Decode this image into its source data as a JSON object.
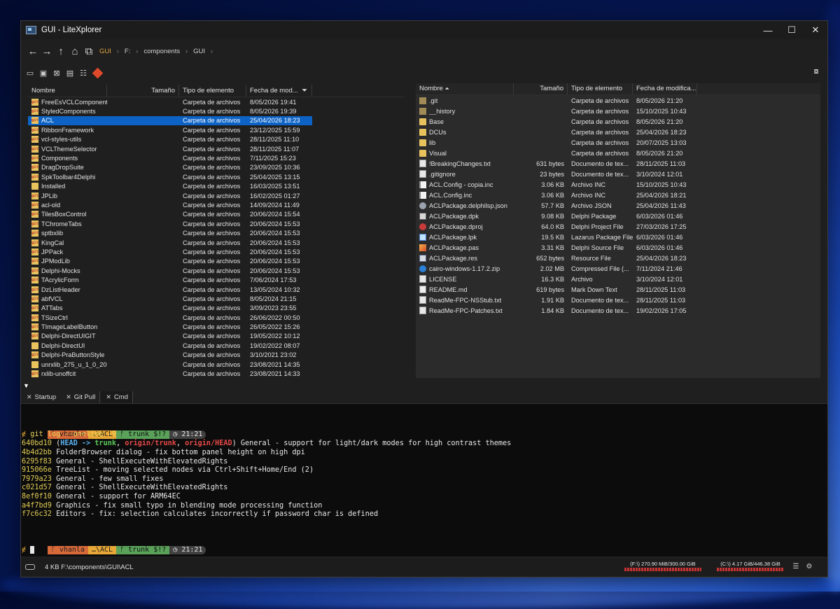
{
  "window": {
    "title": "GUI - LiteXplorer"
  },
  "controls": {
    "minimize": "—",
    "maximize": "☐",
    "close": "✕"
  },
  "nav": {
    "back": "←",
    "forward": "→",
    "up": "↑",
    "home": "⌂",
    "copy": "⧉",
    "breadcrumbs": [
      "GUI",
      "F:",
      "components",
      "GUI"
    ],
    "sep": "›"
  },
  "toolbar": {
    "icons": [
      "panel-toggle-icon",
      "new-folder-icon",
      "delete-icon",
      "properties-icon",
      "view-icon",
      "git-icon"
    ],
    "right_icon": "screenshot-icon"
  },
  "left_pane": {
    "columns": [
      "Nombre",
      "Tamaño",
      "Tipo de elemento",
      "Fecha de mod..."
    ],
    "sort_indicator": "⏷",
    "rows": [
      {
        "name": "FreeEsVCLComponents",
        "type": "Carpeta de archivos",
        "date": "8/05/2026 19:41",
        "icon": "git"
      },
      {
        "name": "StyledComponents",
        "type": "Carpeta de archivos",
        "date": "8/05/2026 19:39",
        "icon": "git"
      },
      {
        "name": "ACL",
        "type": "Carpeta de archivos",
        "date": "25/04/2026 18:23",
        "icon": "git",
        "selected": true
      },
      {
        "name": "RibbonFramework",
        "type": "Carpeta de archivos",
        "date": "23/12/2025 15:59",
        "icon": "git"
      },
      {
        "name": "vcl-styles-utils",
        "type": "Carpeta de archivos",
        "date": "28/11/2025 11:10",
        "icon": "git"
      },
      {
        "name": "VCLThemeSelector",
        "type": "Carpeta de archivos",
        "date": "28/11/2025 11:07",
        "icon": "git"
      },
      {
        "name": "Components",
        "type": "Carpeta de archivos",
        "date": "7/11/2025 15:23",
        "icon": "git"
      },
      {
        "name": "DragDropSuite",
        "type": "Carpeta de archivos",
        "date": "23/09/2025 10:36",
        "icon": "git"
      },
      {
        "name": "SpkToolbar4Delphi",
        "type": "Carpeta de archivos",
        "date": "25/04/2025 13:15",
        "icon": "git"
      },
      {
        "name": "Installed",
        "type": "Carpeta de archivos",
        "date": "16/03/2025 13:51",
        "icon": "folder"
      },
      {
        "name": "JPLib",
        "type": "Carpeta de archivos",
        "date": "16/02/2025 01:27",
        "icon": "git"
      },
      {
        "name": "acl-old",
        "type": "Carpeta de archivos",
        "date": "14/09/2024 11:49",
        "icon": "git"
      },
      {
        "name": "TilesBoxControl",
        "type": "Carpeta de archivos",
        "date": "20/06/2024 15:54",
        "icon": "git"
      },
      {
        "name": "TChromeTabs",
        "type": "Carpeta de archivos",
        "date": "20/06/2024 15:53",
        "icon": "git"
      },
      {
        "name": "sptbxlib",
        "type": "Carpeta de archivos",
        "date": "20/06/2024 15:53",
        "icon": "git"
      },
      {
        "name": "KingCal",
        "type": "Carpeta de archivos",
        "date": "20/06/2024 15:53",
        "icon": "git"
      },
      {
        "name": "JPPack",
        "type": "Carpeta de archivos",
        "date": "20/06/2024 15:53",
        "icon": "git"
      },
      {
        "name": "JPModLib",
        "type": "Carpeta de archivos",
        "date": "20/06/2024 15:53",
        "icon": "git"
      },
      {
        "name": "Delphi-Mocks",
        "type": "Carpeta de archivos",
        "date": "20/06/2024 15:53",
        "icon": "git"
      },
      {
        "name": "TAcrylicForm",
        "type": "Carpeta de archivos",
        "date": "7/06/2024 17:53",
        "icon": "git"
      },
      {
        "name": "DzListHeader",
        "type": "Carpeta de archivos",
        "date": "13/05/2024 10:32",
        "icon": "git"
      },
      {
        "name": "abfVCL",
        "type": "Carpeta de archivos",
        "date": "8/05/2024 21:15",
        "icon": "git"
      },
      {
        "name": "ATTabs",
        "type": "Carpeta de archivos",
        "date": "3/09/2023 23:55",
        "icon": "git"
      },
      {
        "name": "TSizeCtrl",
        "type": "Carpeta de archivos",
        "date": "26/06/2022 00:50",
        "icon": "git"
      },
      {
        "name": "TImageLabelButton",
        "type": "Carpeta de archivos",
        "date": "26/05/2022 15:26",
        "icon": "git"
      },
      {
        "name": "Delphi-DirectUIGIT",
        "type": "Carpeta de archivos",
        "date": "19/05/2022 10:12",
        "icon": "git"
      },
      {
        "name": "Delphi-DirectUI",
        "type": "Carpeta de archivos",
        "date": "19/02/2022 08:07",
        "icon": "folder"
      },
      {
        "name": "Delphi-PraButtonStyle",
        "type": "Carpeta de archivos",
        "date": "3/10/2021 23:02",
        "icon": "git"
      },
      {
        "name": "unrxlib_275_u_1_0_20",
        "type": "Carpeta de archivos",
        "date": "23/08/2021 14:35",
        "icon": "folder"
      },
      {
        "name": "rxlib-unoffcit",
        "type": "Carpeta de archivos",
        "date": "23/08/2021 14:33",
        "icon": "git"
      }
    ]
  },
  "right_pane": {
    "columns": [
      "Nombre",
      "Tamaño",
      "Tipo de elemento",
      "Fecha de modifica..."
    ],
    "sort_indicator": "⏶",
    "rows": [
      {
        "name": ".git",
        "size": "",
        "type": "Carpeta de archivos",
        "date": "8/05/2026 21:20",
        "icon": "folder-dark"
      },
      {
        "name": "__history",
        "size": "",
        "type": "Carpeta de archivos",
        "date": "15/10/2025 10:43",
        "icon": "folder-dark"
      },
      {
        "name": "Base",
        "size": "",
        "type": "Carpeta de archivos",
        "date": "8/05/2026 21:20",
        "icon": "folder"
      },
      {
        "name": "DCUs",
        "size": "",
        "type": "Carpeta de archivos",
        "date": "25/04/2026 18:23",
        "icon": "folder"
      },
      {
        "name": "lib",
        "size": "",
        "type": "Carpeta de archivos",
        "date": "20/07/2025 13:03",
        "icon": "folder"
      },
      {
        "name": "Visual",
        "size": "",
        "type": "Carpeta de archivos",
        "date": "8/05/2026 21:20",
        "icon": "folder"
      },
      {
        "name": "!BreakingChanges.txt",
        "size": "631 bytes",
        "type": "Documento de tex...",
        "date": "28/11/2025 11:03",
        "icon": "txt"
      },
      {
        "name": ".gitignore",
        "size": "23 bytes",
        "type": "Documento de tex...",
        "date": "3/10/2024 12:01",
        "icon": "txt"
      },
      {
        "name": "ACL.Config - copia.inc",
        "size": "3.06 KB",
        "type": "Archivo INC",
        "date": "15/10/2025 10:43",
        "icon": "inc"
      },
      {
        "name": "ACL.Config.inc",
        "size": "3.06 KB",
        "type": "Archivo INC",
        "date": "25/04/2026 18:21",
        "icon": "inc"
      },
      {
        "name": "ACLPackage.delphilsp.json",
        "size": "57.7 KB",
        "type": "Archivo JSON",
        "date": "25/04/2026 11:43",
        "icon": "json"
      },
      {
        "name": "ACLPackage.dpk",
        "size": "9.08 KB",
        "type": "Delphi Package",
        "date": "6/03/2026 01:46",
        "icon": "dpk"
      },
      {
        "name": "ACLPackage.dproj",
        "size": "64.0 KB",
        "type": "Delphi Project File",
        "date": "27/03/2026 17:25",
        "icon": "dproj"
      },
      {
        "name": "ACLPackage.lpk",
        "size": "19.5 KB",
        "type": "Lazarus Package File",
        "date": "6/03/2026 01:46",
        "icon": "lpk"
      },
      {
        "name": "ACLPackage.pas",
        "size": "3.31 KB",
        "type": "Delphi Source File",
        "date": "6/03/2026 01:46",
        "icon": "pas"
      },
      {
        "name": "ACLPackage.res",
        "size": "652 bytes",
        "type": "Resource File",
        "date": "25/04/2026 18:23",
        "icon": "res"
      },
      {
        "name": "cairo-windows-1.17.2.zip",
        "size": "2.02 MB",
        "type": "Compressed File (...",
        "date": "7/11/2024 21:46",
        "icon": "zip"
      },
      {
        "name": "LICENSE",
        "size": "16.3 KB",
        "type": "Archivo",
        "date": "3/10/2024 12:01",
        "icon": "txt"
      },
      {
        "name": "README.md",
        "size": "619 bytes",
        "type": "Mark Down Text",
        "date": "28/11/2025 11:03",
        "icon": "md"
      },
      {
        "name": "ReadMe-FPC-NSStub.txt",
        "size": "1.91 KB",
        "type": "Documento de tex...",
        "date": "28/11/2025 11:03",
        "icon": "txt"
      },
      {
        "name": "ReadMe-FPC-Patches.txt",
        "size": "1.84 KB",
        "type": "Documento de tex...",
        "date": "19/02/2026 17:05",
        "icon": "txt"
      }
    ]
  },
  "tabs": [
    {
      "label": "Startup",
      "active": false
    },
    {
      "label": "Git Pull",
      "active": false
    },
    {
      "label": "Cmd",
      "active": true
    }
  ],
  "tab_close": "✕",
  "terminal": {
    "prompt": {
      "user": "ᚴ vhanla",
      "path": "…\\ACL",
      "branch1": "ᚠ trunk $!?",
      "branch2": "ᚠ trunk $!?",
      "time": "◷ 21:21"
    },
    "prompt_char": "ɇ",
    "command": "git log --oneline -9",
    "first_commit": {
      "hash": "640bd10",
      "open": " (",
      "head": "HEAD -> ",
      "trunk": "trunk",
      "comma1": ", ",
      "origin_trunk": "origin/trunk",
      "comma2": ", ",
      "origin_head": "origin/HEAD",
      "close": ")",
      "msg": " General - support for light/dark modes for high contrast themes"
    },
    "commits": [
      {
        "hash": "4b4d2bb",
        "msg": " FolderBrowser dialog - fix bottom panel height on high dpi"
      },
      {
        "hash": "6295f83",
        "msg": " General - ShellExecuteWithElevatedRights"
      },
      {
        "hash": "915066e",
        "msg": " TreeList - moving selected nodes via Ctrl+Shift+Home/End (2)"
      },
      {
        "hash": "7979a23",
        "msg": " General - few small fixes"
      },
      {
        "hash": "c021d57",
        "msg": " General - ShellExecuteWithElevatedRights"
      },
      {
        "hash": "8ef0f10",
        "msg": " General - support for ARM64EC"
      },
      {
        "hash": "a4f7bd9",
        "msg": " Graphics - fix small typo in blending mode processing function"
      },
      {
        "hash": "f7c6c32",
        "msg": " Editors - fix: selection calculates incorrectly if password char is defined"
      }
    ]
  },
  "status": {
    "info": "4 KB  F:\\components\\GUI\\ACL",
    "drive_f": "(F:\\) 270.90 MiB/300.00 GiB",
    "drive_c": "(C:\\) 4.17 GiB/446.38 GiB"
  },
  "colors": {
    "accent": "#0d63c5",
    "breadcrumb_active": "#e5a640",
    "drive_bar": "#c83232"
  }
}
